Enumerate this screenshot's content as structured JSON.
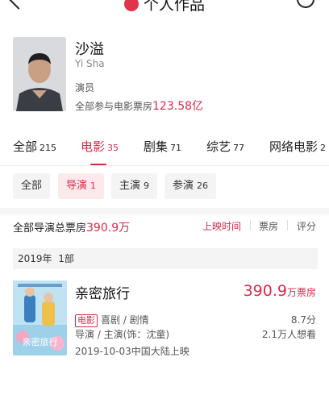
{
  "header": {
    "title": "个人作品"
  },
  "profile": {
    "name": "沙溢",
    "en_name": "Yi Sha",
    "role": "演员",
    "boxoffice_prefix": "全部参与电影票房",
    "boxoffice_value": "123.58亿"
  },
  "category_tabs": [
    {
      "label": "全部",
      "count": "215"
    },
    {
      "label": "电影",
      "count": "35"
    },
    {
      "label": "剧集",
      "count": "71"
    },
    {
      "label": "综艺",
      "count": "77"
    },
    {
      "label": "网络电影",
      "count": "2"
    }
  ],
  "sub_tabs": [
    {
      "label": "全部",
      "count": ""
    },
    {
      "label": "导演",
      "count": "1"
    },
    {
      "label": "主演",
      "count": "9"
    },
    {
      "label": "参演",
      "count": "26"
    }
  ],
  "summary": {
    "prefix": "全部导演总票房",
    "value": "390.9万",
    "sort_options": [
      "上映时间",
      "票房",
      "评分"
    ]
  },
  "year_group": {
    "year": "2019年",
    "count": "1部"
  },
  "movie": {
    "title": "亲密旅行",
    "boxoffice_value": "390.9",
    "boxoffice_unit": "万票房",
    "badge": "电影",
    "genres": "喜剧 / 剧情",
    "role": "导演 / 主演(饰：沈童)",
    "release": "2019-10-03中国大陆上映",
    "score": "8.7分",
    "wish": "2.1万人想看",
    "poster_text": "亲密旅行"
  }
}
